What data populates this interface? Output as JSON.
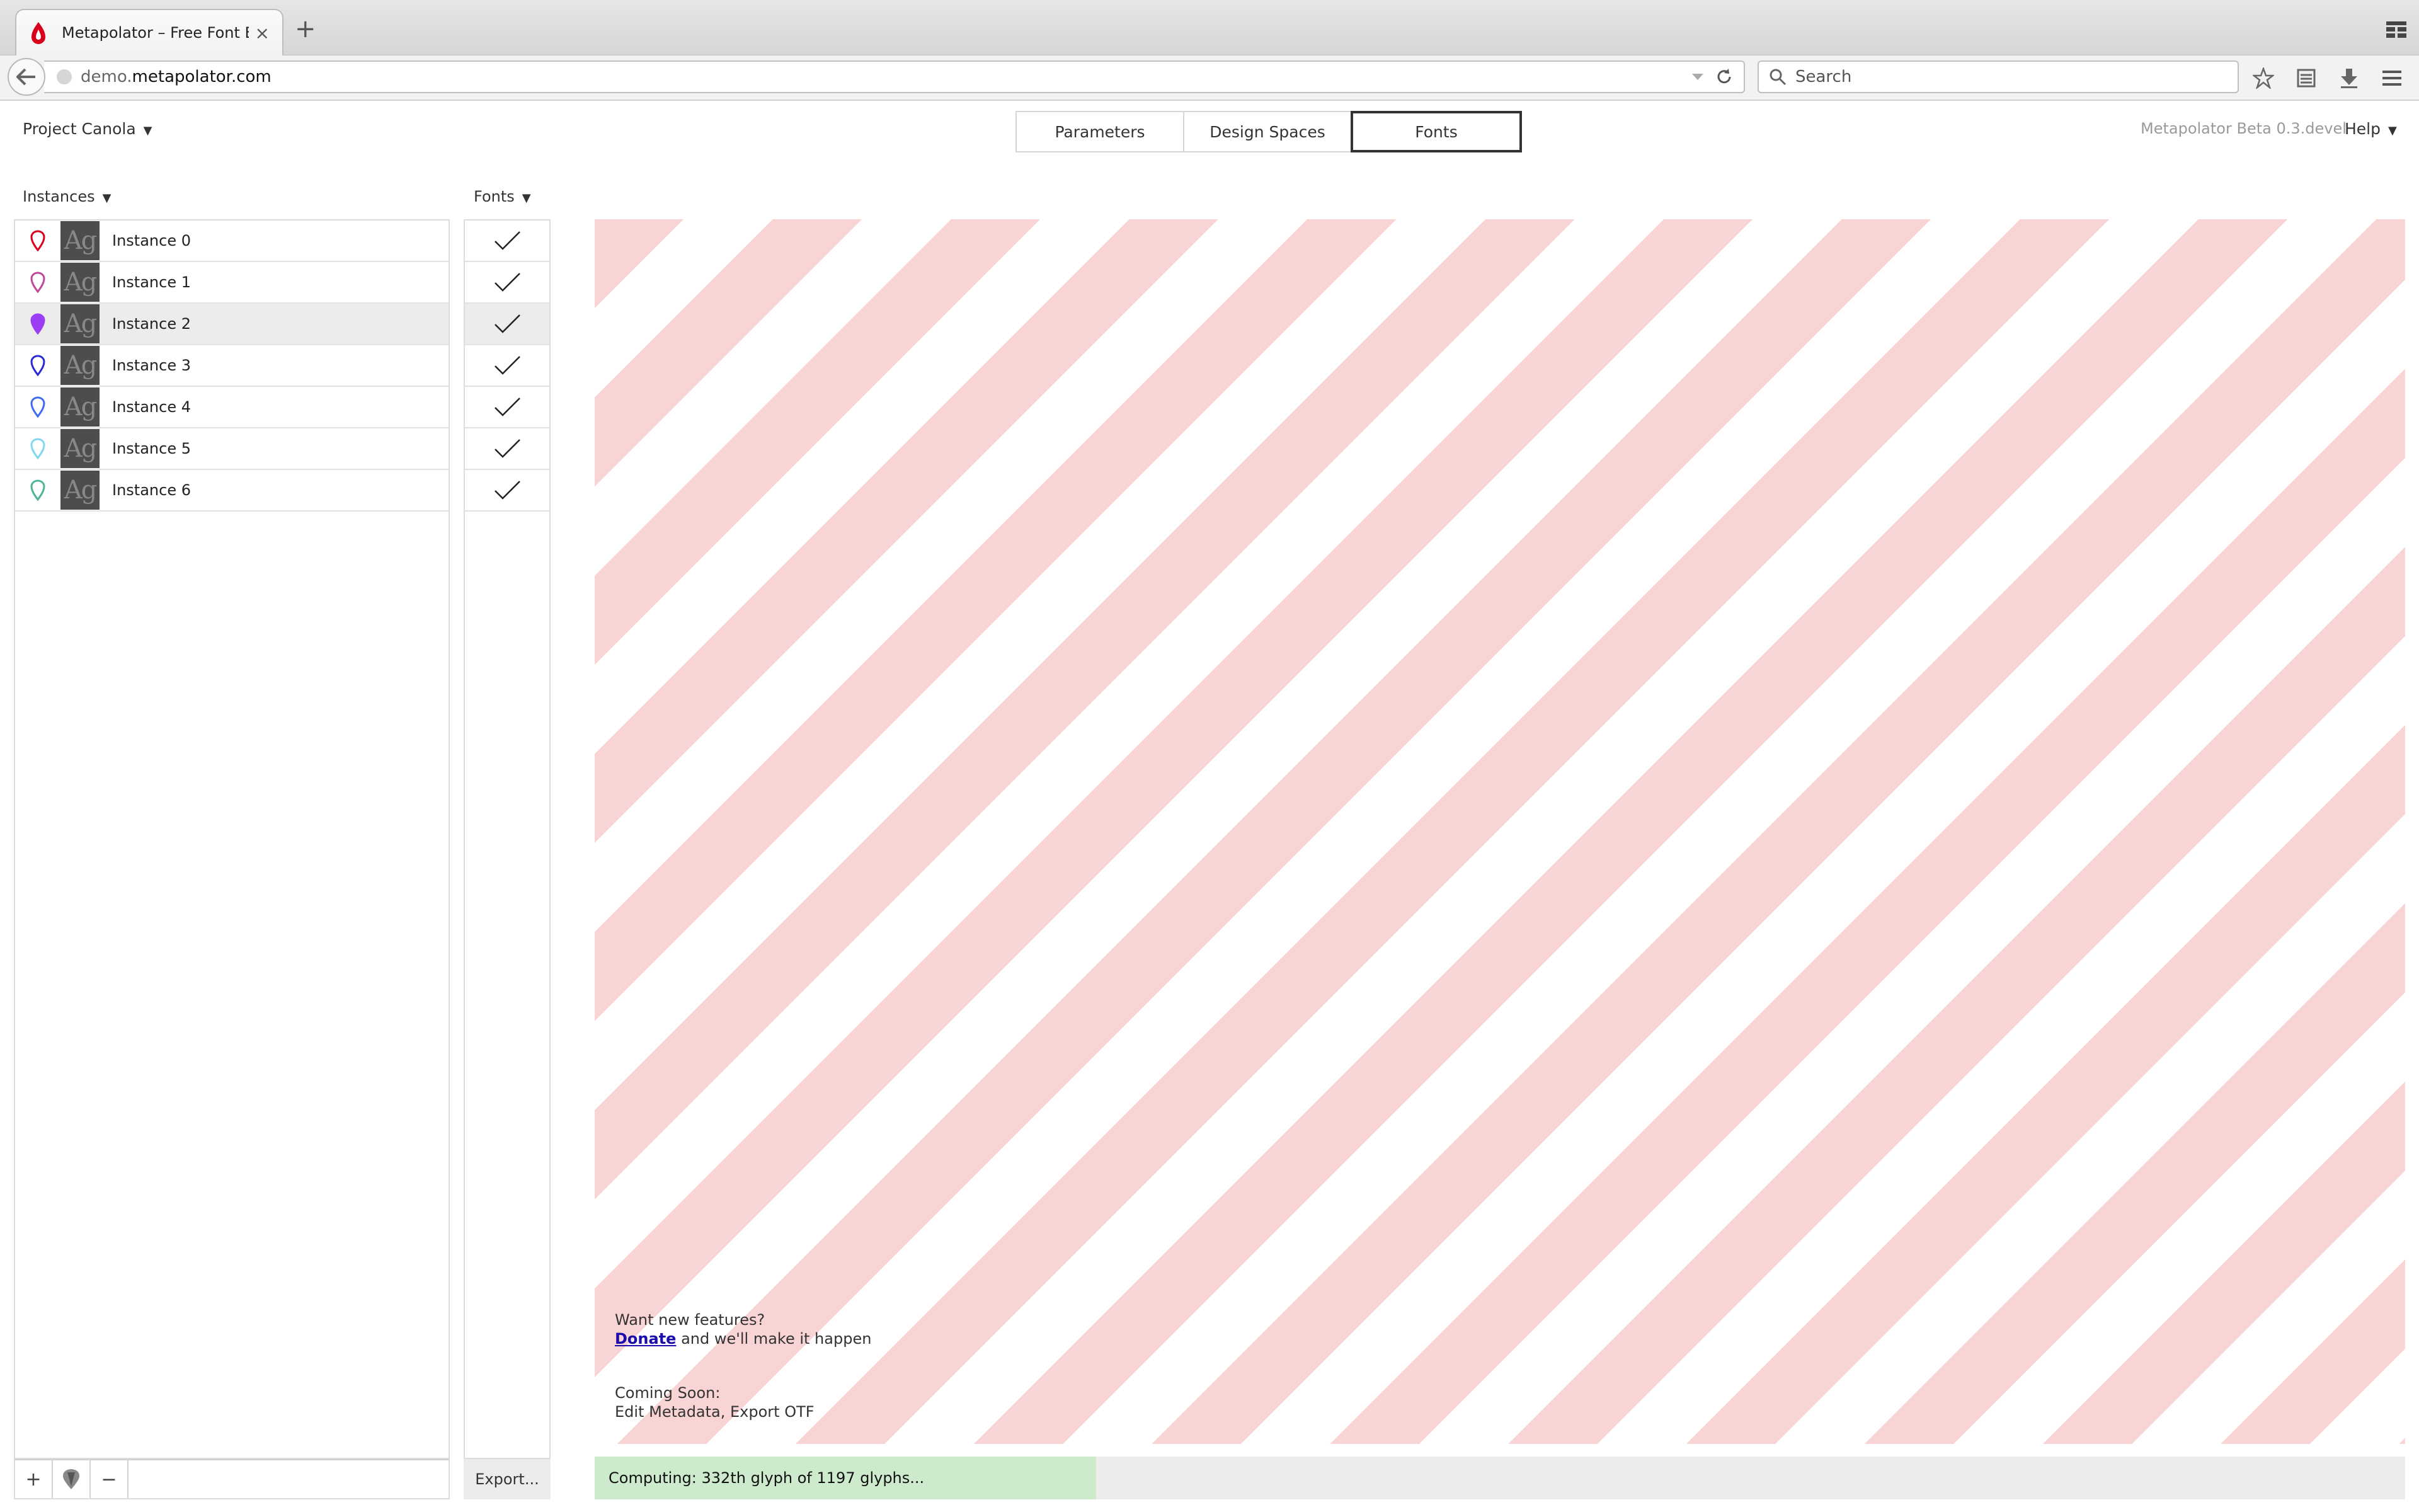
{
  "browser": {
    "tab_title": "Metapolator – Free Font E...",
    "new_tab": "+",
    "close_tab": "×",
    "url_prefix": "demo.",
    "url_host": "metapolator.com",
    "search_placeholder": "Search"
  },
  "header": {
    "project": "Project Canola",
    "tabs": [
      "Parameters",
      "Design Spaces",
      "Fonts"
    ],
    "active_tab": "Fonts",
    "version": "Metapolator Beta 0.3.devel",
    "help": "Help"
  },
  "instances_panel": {
    "label": "Instances",
    "thumb_text": "Ag",
    "items": [
      {
        "name": "Instance 0",
        "color": "#d9001b",
        "filled": false
      },
      {
        "name": "Instance 1",
        "color": "#c0479a",
        "filled": false
      },
      {
        "name": "Instance 2",
        "color": "#9b3df2",
        "filled": true
      },
      {
        "name": "Instance 3",
        "color": "#2b2bd6",
        "filled": false
      },
      {
        "name": "Instance 4",
        "color": "#3f6bf2",
        "filled": false
      },
      {
        "name": "Instance 5",
        "color": "#7fd8f0",
        "filled": false
      },
      {
        "name": "Instance 6",
        "color": "#4fb39a",
        "filled": false
      }
    ],
    "selected_index": 2,
    "footer": {
      "add": "+",
      "remove": "−"
    }
  },
  "fonts_panel": {
    "label": "Fonts",
    "export": "Export..."
  },
  "preview": {
    "promo_line1": "Want new features?",
    "donate_link": "Donate",
    "promo_line2_rest": " and we'll make it happen",
    "soon_title": "Coming Soon:",
    "soon_items": "Edit Metadata, Export OTF"
  },
  "status": {
    "text": "Computing: 332th glyph of 1197 glyphs...",
    "progress": 0.277
  },
  "colors": {
    "stripe": "#f9d4d4",
    "progress_fill": "#cdeacd",
    "active_tab_border": "#333333"
  }
}
